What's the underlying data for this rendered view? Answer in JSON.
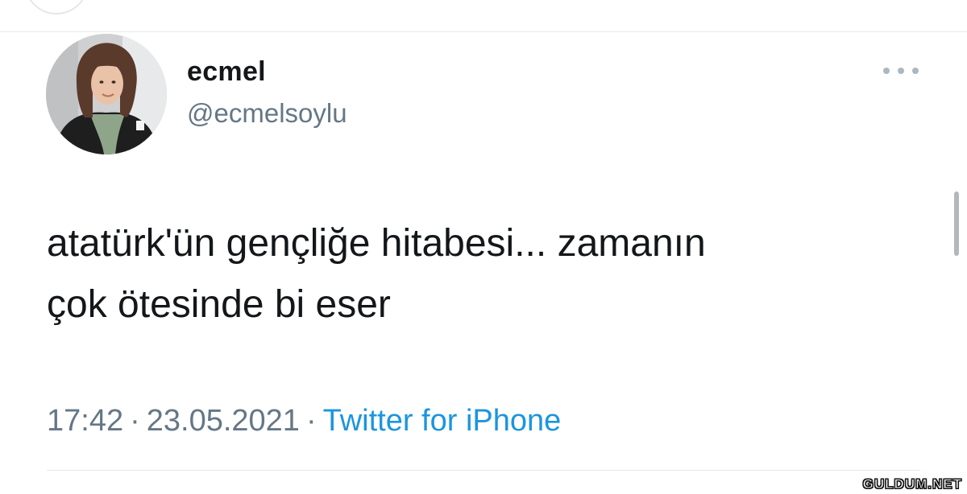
{
  "tweet": {
    "display_name": "ecmel",
    "handle": "@ecmelsoylu",
    "text": "atatürk'ün gençliğe hitabesi... zamanın\nçok ötesinde bi eser",
    "time": "17:42",
    "separator": "·",
    "date": "23.05.2021",
    "source": "Twitter for iPhone"
  },
  "icons": {
    "more": "more-horizontal-icon",
    "avatar": "profile-photo"
  },
  "watermark": "GULDUM.NET",
  "colors": {
    "text": "#14171a",
    "muted": "#657786",
    "link": "#1b95e0",
    "divider": "#e1e8ed"
  }
}
